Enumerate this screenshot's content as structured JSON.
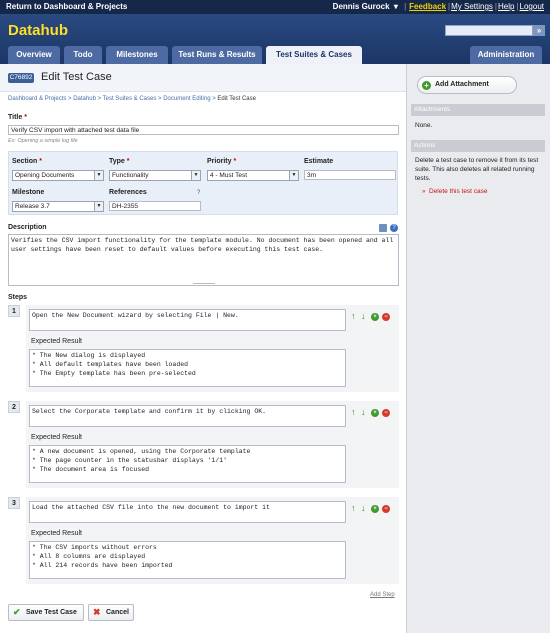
{
  "topbar": {
    "return_link": "Return to Dashboard & Projects",
    "user": "Dennis Gurock",
    "feedback": "Feedback",
    "my_settings": "My Settings",
    "help": "Help",
    "logout": "Logout"
  },
  "header": {
    "brand": "Datahub",
    "search_button": "»",
    "tabs": [
      "Overview",
      "Todo",
      "Milestones",
      "Test Runs & Results",
      "Test Suites & Cases"
    ],
    "admin_tab": "Administration"
  },
  "page": {
    "id_badge": "C76892",
    "title": "Edit Test Case",
    "breadcrumbs": [
      "Dashboard & Projects",
      "Datahub",
      "Test Suites & Cases",
      "Document Editing",
      "Edit Test Case"
    ]
  },
  "form": {
    "title_label": "Title",
    "title_value": "Verify CSV import with attached test data file",
    "title_hint": "Ex: Opening a simple log file",
    "section_label": "Section",
    "section_value": "Opening Documents",
    "type_label": "Type",
    "type_value": "Functionality",
    "priority_label": "Priority",
    "priority_value": "4 - Must Test",
    "estimate_label": "Estimate",
    "estimate_value": "3m",
    "milestone_label": "Milestone",
    "milestone_value": "Release 3.7",
    "references_label": "References",
    "references_value": "DH-2355",
    "references_help": "?",
    "description_label": "Description",
    "description_value": "Verifies the CSV import functionality for the template module. No document has been opened and all user settings have been reset to default values before executing this test case.",
    "steps_label": "Steps",
    "expected_label": "Expected Result",
    "steps": [
      {
        "number": "1",
        "action": "Open the New Document wizard by selecting File | New.",
        "expected": "* The New dialog is displayed\n* All default templates have been loaded\n* The Empty template has been pre-selected"
      },
      {
        "number": "2",
        "action": "Select the Corporate template and confirm it by clicking OK.",
        "expected": "* A new document is opened, using the Corporate template\n* The page counter in the statusbar displays '1/1'\n* The document area is focused"
      },
      {
        "number": "3",
        "action": "Load the attached CSV file into the new document to import it",
        "expected": "* The CSV imports without errors\n* All 8 columns are displayed\n* All 214 records have been imported"
      }
    ],
    "add_step": "Add Step",
    "save_button": "Save Test Case",
    "cancel_button": "Cancel"
  },
  "sidebar": {
    "add_attachment": "Add Attachment",
    "attachments_header": "Attachments",
    "attachments_value": "None.",
    "actions_header": "Actions",
    "actions_text": "Delete a test case to remove it from its test suite. This also deletes all related running tests.",
    "delete_link": "Delete this test case"
  },
  "colors": {
    "topbar": "#16284a",
    "header": "#1c3665",
    "brand": "#ffde2a",
    "feedback": "#f2d000",
    "link": "#4a6da6",
    "delete": "#c41616",
    "add_green": "#3f9a2c",
    "remove_red": "#d23a2a"
  }
}
